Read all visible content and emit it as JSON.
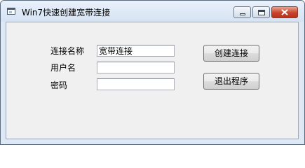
{
  "window": {
    "title": "Win7快速创建宽带连接"
  },
  "form": {
    "connection_name_label": "连接名称",
    "connection_name_value": "宽带连接",
    "username_label": "用户名",
    "username_value": "",
    "password_label": "密码",
    "password_value": ""
  },
  "buttons": {
    "create_label": "创建连接",
    "exit_label": "退出程序"
  },
  "icons": {
    "app": "window-app-icon",
    "minimize": "minimize-icon",
    "maximize": "maximize-icon",
    "close": "close-icon"
  },
  "colors": {
    "title_bar": "#dfe9f5",
    "client_bg": "#f0f0f0",
    "close_button": "#c8432a"
  }
}
